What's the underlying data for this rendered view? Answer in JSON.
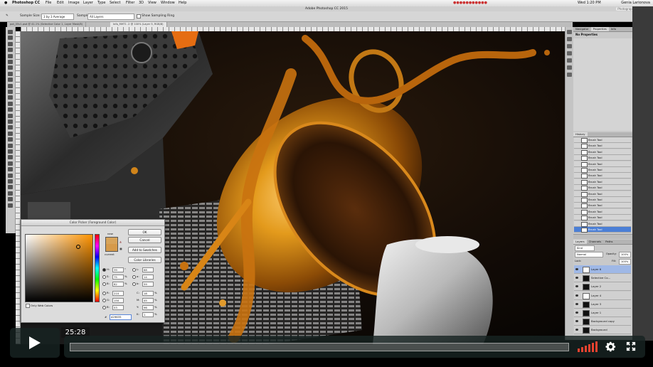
{
  "menubar": {
    "app_name": "Photoshop CC",
    "menus": [
      "File",
      "Edit",
      "Image",
      "Layer",
      "Type",
      "Select",
      "Filter",
      "3D",
      "View",
      "Window",
      "Help"
    ],
    "clock": "Wed 1:20 PM",
    "user": "Genia Larionova"
  },
  "ps": {
    "window_title": "Adobe Photoshop CC 2015",
    "workspace": "Photography",
    "options": {
      "sample_size_label": "Sample Size:",
      "sample_size_value": "3 by 3 Average",
      "sample_label": "Sample:",
      "sample_value": "All Layers",
      "show_ring_label": "Show Sampling Ring"
    },
    "doc_tabs": [
      "pot_05v1.psd @ 41.1% (Selective Color 1, Layer Mask/8)",
      "Info_MHT1 .2 @ 100% (Layer 5, RGB/8)"
    ],
    "ruler_marks": [
      "800",
      "900",
      "1000",
      "1100",
      "1200",
      "1300",
      "1400",
      "1500",
      "1600",
      "1700",
      "1800",
      "1900",
      "2000",
      "2100",
      "2200",
      "2300",
      "2400",
      "2500",
      "2600",
      "2700",
      "2800"
    ]
  },
  "panels": {
    "top_tabs": [
      "Navigator",
      "Properties",
      "Info"
    ],
    "no_properties": "No Properties",
    "history_tab": "History",
    "history_items": [
      "Brush Tool",
      "Brush Tool",
      "Brush Tool",
      "Brush Tool",
      "Brush Tool",
      "Brush Tool",
      "Brush Tool",
      "Brush Tool",
      "Brush Tool",
      "Brush Tool",
      "Brush Tool",
      "Brush Tool",
      "Brush Tool",
      "Brush Tool",
      "Brush Tool",
      "Brush Tool"
    ],
    "layers_tabs": [
      "Layers",
      "Channels",
      "Paths"
    ],
    "kind": "Kind",
    "blend_mode": "Normal",
    "opacity_label": "Opacity:",
    "opacity": "100%",
    "lock_label": "Lock:",
    "fill_label": "Fill:",
    "fill": "100%",
    "layers": [
      "Layer 6",
      "Selective Co...",
      "Layer 2",
      "Layer 4",
      "Layer 3",
      "Layer 1",
      "Background copy",
      "Background"
    ]
  },
  "color_picker": {
    "title": "Color Picker (Foreground Color)",
    "ok": "OK",
    "cancel": "Cancel",
    "add_to_swatches": "Add to Swatches",
    "color_libraries": "Color Libraries",
    "new_label": "new",
    "current_label": "current",
    "only_web_colors": "Only Web Colors",
    "hex_label": "#",
    "hex": "d29635",
    "hsb": [
      {
        "label": "H:",
        "value": "39",
        "unit": "°"
      },
      {
        "label": "S:",
        "value": "75",
        "unit": "%"
      },
      {
        "label": "B:",
        "value": "82",
        "unit": "%"
      }
    ],
    "rgb": [
      {
        "label": "R:",
        "value": "210"
      },
      {
        "label": "G:",
        "value": "150"
      },
      {
        "label": "B:",
        "value": "53"
      }
    ],
    "lab": [
      {
        "label": "L:",
        "value": "68"
      },
      {
        "label": "a:",
        "value": "14"
      },
      {
        "label": "b:",
        "value": "59"
      }
    ],
    "cmyk": [
      {
        "label": "C:",
        "value": "18",
        "unit": "%"
      },
      {
        "label": "M:",
        "value": "45",
        "unit": "%"
      },
      {
        "label": "Y:",
        "value": "96",
        "unit": "%"
      },
      {
        "label": "K:",
        "value": "1",
        "unit": "%"
      }
    ]
  },
  "player": {
    "timecode": "25:28",
    "progress_fraction": 0.0,
    "accent_color": "#e8422f",
    "icons": [
      "play-icon",
      "volume-icon",
      "settings-gear-icon",
      "fullscreen-icon"
    ]
  }
}
